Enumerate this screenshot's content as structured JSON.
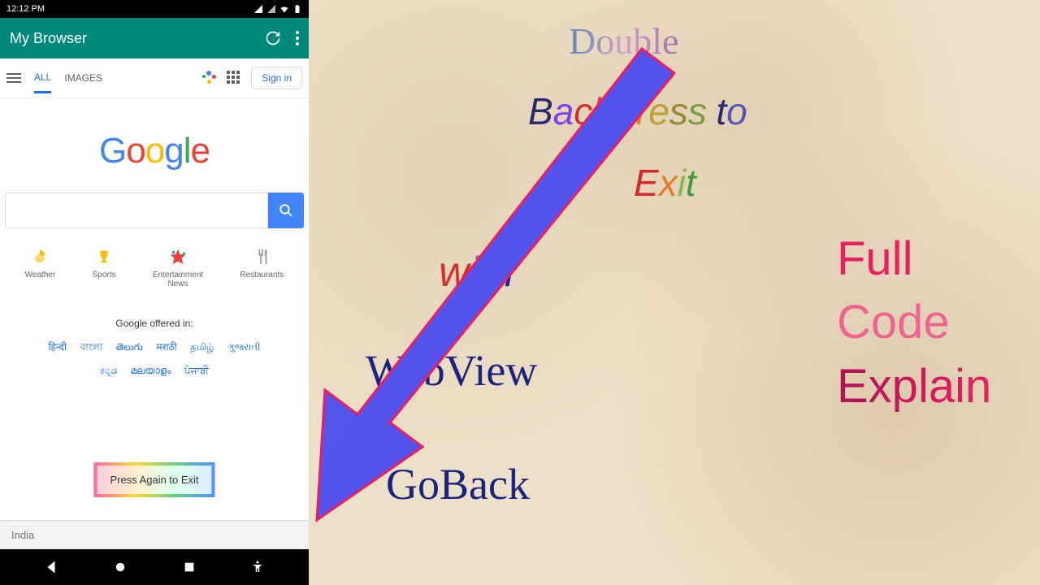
{
  "status": {
    "time": "12:12 PM"
  },
  "appbar": {
    "title": "My Browser"
  },
  "tabs": {
    "all": "ALL",
    "images": "IMAGES"
  },
  "signin": "Sign in",
  "logo": [
    "G",
    "o",
    "o",
    "g",
    "l",
    "e"
  ],
  "search": {
    "placeholder": ""
  },
  "quick": {
    "weather": "Weather",
    "sports": "Sports",
    "ent": "Entertainment\nNews",
    "restaurants": "Restaurants"
  },
  "offered": "Google offered in:",
  "langs": [
    "हिन्दी",
    "বাংলা",
    "తెలుగు",
    "मराठी",
    "தமிழ்",
    "ગુજરાતી",
    "ಕನ್ನಡ",
    "മലയാളം",
    "ਪੰਜਾਬੀ"
  ],
  "toast": "Press Again to Exit",
  "footer": "India",
  "heads": {
    "h1": "Double",
    "h2": "BackPress to",
    "hx": "Exit",
    "h3": "with",
    "h4": "WebView",
    "h5": "GoBack",
    "h6a": "Full",
    "h6b": "Code",
    "h6c": "Explain"
  }
}
